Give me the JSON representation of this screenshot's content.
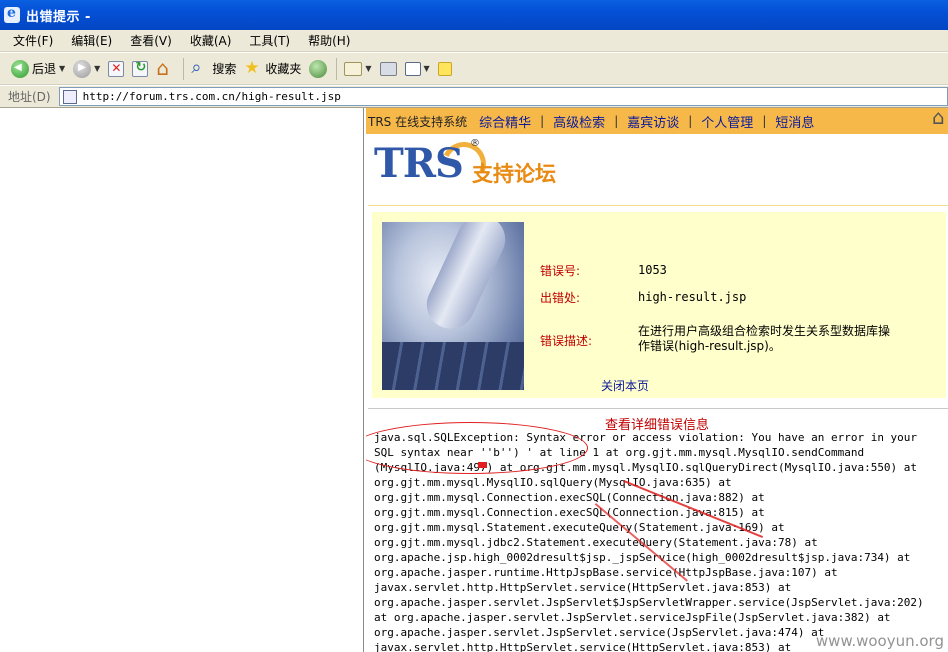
{
  "window": {
    "title": "出错提示 -"
  },
  "menu": [
    "文件(F)",
    "编辑(E)",
    "查看(V)",
    "收藏(A)",
    "工具(T)",
    "帮助(H)"
  ],
  "toolbar": {
    "back_label": "后退",
    "search_label": "搜索",
    "favorites_label": "收藏夹"
  },
  "address": {
    "label": "地址(D)",
    "url": "http://forum.trs.com.cn/high-result.jsp"
  },
  "site_nav": {
    "brand": "TRS 在线支持系统",
    "links": [
      "综合精华",
      "高级检索",
      "嘉宾访谈",
      "个人管理",
      "短消息"
    ]
  },
  "logo": {
    "text": "TRS",
    "reg": "®",
    "tagline": "支持论坛"
  },
  "error": {
    "code_label": "错误号:",
    "code_value": "1053",
    "location_label": "出错处:",
    "location_value": "high-result.jsp",
    "desc_label": "错误描述:",
    "desc_value": "在进行用户高级组合检索时发生关系型数据库操作错误(high-result.jsp)。",
    "close_link": "关闭本页"
  },
  "detail": {
    "title": "查看详细错误信息",
    "trace": [
      "java.sql.SQLException: Syntax error or access violation: You have an error in your",
      "SQL syntax near ''b'') ' at line 1 at org.gjt.mm.mysql.MysqlIO.sendCommand",
      "(MysqlIO.java:497) at org.gjt.mm.mysql.MysqlIO.sqlQueryDirect(MysqlIO.java:550) at",
      "org.gjt.mm.mysql.MysqlIO.sqlQuery(MysqlIO.java:635) at",
      "org.gjt.mm.mysql.Connection.execSQL(Connection.java:882) at",
      "org.gjt.mm.mysql.Connection.execSQL(Connection.java:815) at",
      "org.gjt.mm.mysql.Statement.executeQuery(Statement.java:169) at",
      "org.gjt.mm.mysql.jdbc2.Statement.executeQuery(Statement.java:78) at",
      "org.apache.jsp.high_0002dresult$jsp._jspService(high_0002dresult$jsp.java:734) at",
      "org.apache.jasper.runtime.HttpJspBase.service(HttpJspBase.java:107) at",
      "javax.servlet.http.HttpServlet.service(HttpServlet.java:853) at",
      "org.apache.jasper.servlet.JspServlet$JspServletWrapper.service(JspServlet.java:202)",
      "at org.apache.jasper.servlet.JspServlet.serviceJspFile(JspServlet.java:382) at",
      "org.apache.jasper.servlet.JspServlet.service(JspServlet.java:474) at",
      "javax.servlet.http.HttpServlet.service(HttpServlet.java:853) at"
    ]
  },
  "watermark": "www.wooyun.org",
  "colors": {
    "nav_bg": "#f7b84a",
    "error_panel": "#ffffcc",
    "error_label": "#c00000",
    "link": "#0b1a9c"
  }
}
